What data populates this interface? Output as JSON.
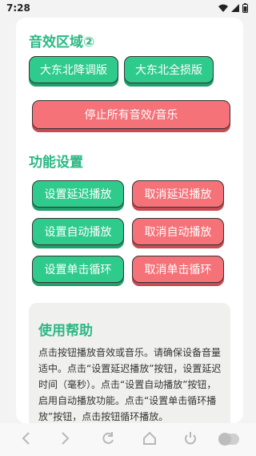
{
  "status_bar": {
    "time": "7:28"
  },
  "sections": {
    "sound": {
      "title": "音效区域②",
      "buttons": [
        "大东北降调版",
        "大东北全损版"
      ],
      "stop_label": "停止所有音效/音乐"
    },
    "features": {
      "title": "功能设置",
      "buttons": [
        {
          "set": "设置延迟播放",
          "cancel": "取消延迟播放"
        },
        {
          "set": "设置自动播放",
          "cancel": "取消自动播放"
        },
        {
          "set": "设置单击循环",
          "cancel": "取消单击循环"
        }
      ]
    },
    "help": {
      "title": "使用帮助",
      "text": "点击按钮播放音效或音乐。请确保设备音量适中。点击“设置延迟播放”按钮，设置延迟时间（毫秒）。点击“设置自动播放”按钮，启用自动播放功能。点击“设置单击循环播放”按钮，点击按钮循环播放。"
    }
  },
  "navbar": {
    "icons": [
      "back-icon",
      "forward-icon",
      "refresh-icon",
      "home-icon",
      "power-icon",
      "toggle-icon"
    ]
  }
}
